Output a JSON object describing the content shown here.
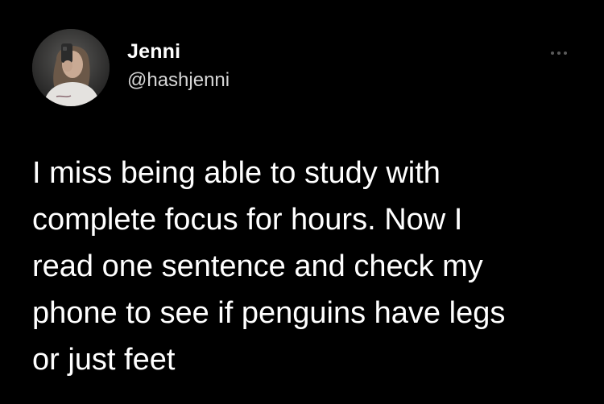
{
  "author": {
    "display_name": "Jenni",
    "handle": "@hashjenni",
    "avatar_icon": "profile-photo"
  },
  "more_icon": "more-dots-icon",
  "tweet": {
    "lines": [
      "I miss being able to study with",
      "complete focus for hours. Now I",
      "read one sentence and check my",
      "phone to see if penguins have legs",
      "or just feet"
    ]
  },
  "colors": {
    "background": "#000000",
    "text": "#ffffff",
    "handle": "#d6d6d6",
    "more_dots": "#5a5a5a"
  }
}
